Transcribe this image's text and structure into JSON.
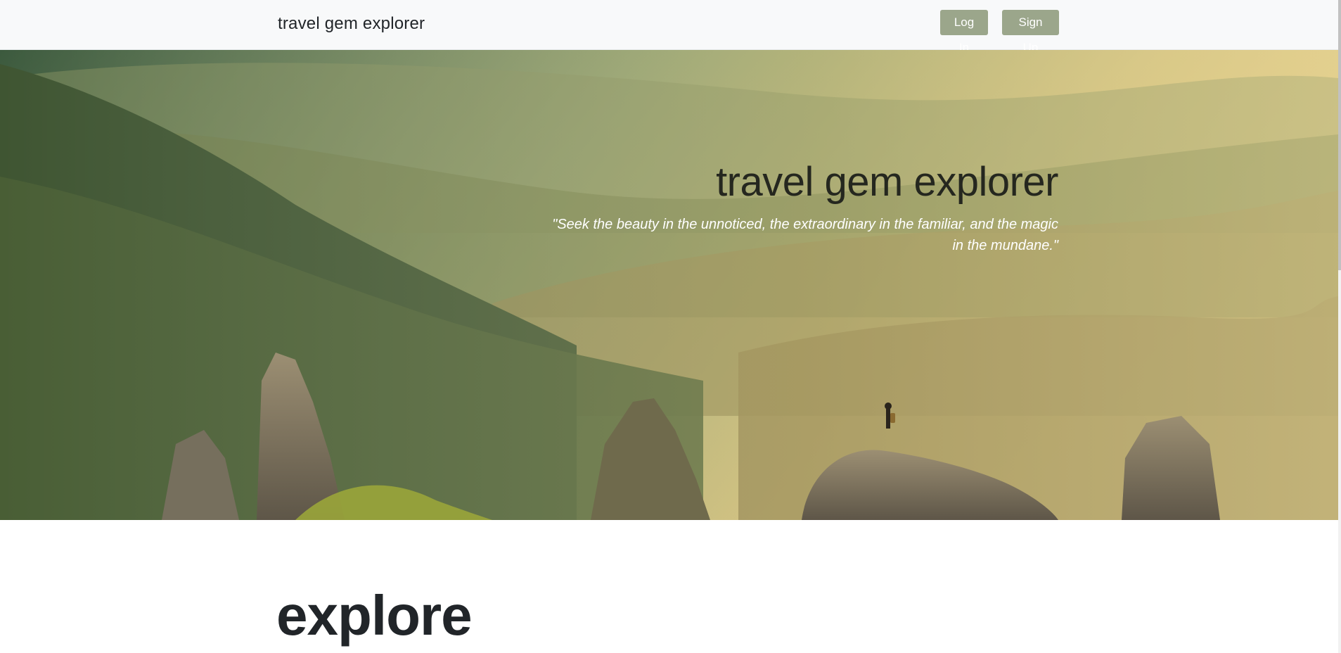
{
  "navbar": {
    "brand": "travel gem explorer",
    "login_label": "Log In",
    "signup_label": "Sign Up"
  },
  "hero": {
    "title": "travel gem explorer",
    "quote": "\"Seek the beauty in the unnoticed, the extraordinary in the familiar, and the magic in the mundane.\"",
    "image_icon": "mountain-landscape-image"
  },
  "main": {
    "heading": "explore"
  },
  "colors": {
    "button_bg": "#9ba68b",
    "navbar_bg": "#f8f9fa",
    "text_dark": "#212529"
  }
}
